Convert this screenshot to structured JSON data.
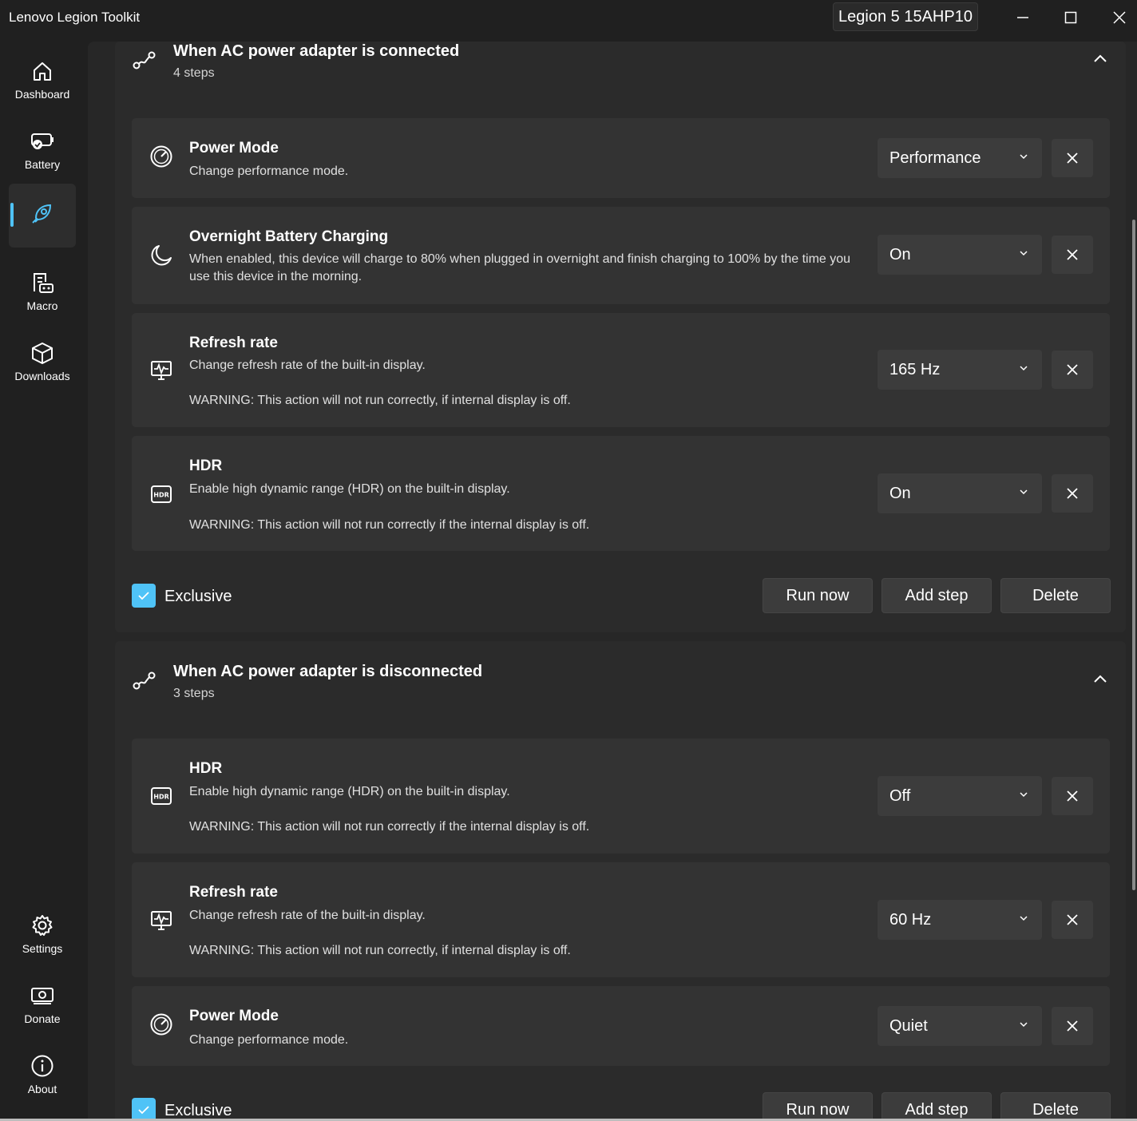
{
  "window": {
    "app_title": "Lenovo Legion Toolkit",
    "device": "Legion 5 15AHP10",
    "controls": [
      "minimize-icon",
      "maximize-icon",
      "close-icon"
    ]
  },
  "sidebar": {
    "items": [
      {
        "label": "Dashboard",
        "icon": "home-icon"
      },
      {
        "label": "Battery",
        "icon": "battery-icon"
      },
      {
        "label": "",
        "icon": "automation-icon",
        "active": true
      },
      {
        "label": "Macro",
        "icon": "macro-icon"
      },
      {
        "label": "Downloads",
        "icon": "box-icon"
      },
      {
        "label": "Settings",
        "icon": "gear-icon"
      },
      {
        "label": "Donate",
        "icon": "money-icon"
      },
      {
        "label": "About",
        "icon": "info-icon"
      }
    ]
  },
  "colors": {
    "accent": "#4fc3f7",
    "background": "#202020",
    "card": "#2b2b2b",
    "step": "#333333",
    "control": "#3c3c3c"
  },
  "pipelines": [
    {
      "title": "When AC power adapter is connected",
      "subtitle": "4 steps",
      "steps": [
        {
          "title": "Power Mode",
          "desc": "Change performance mode.",
          "value": "Performance",
          "icon": "speedometer-icon"
        },
        {
          "title": "Overnight Battery Charging",
          "desc": "When enabled, this device will charge to 80% when plugged in overnight and finish charging to 100% by the time you use this device in the morning.",
          "value": "On",
          "icon": "moon-icon"
        },
        {
          "title": "Refresh rate",
          "desc": "Change refresh rate of the built-in display.",
          "warn": "WARNING: This action will not run correctly, if internal display is off.",
          "value": "165 Hz",
          "icon": "monitor-pulse-icon"
        },
        {
          "title": "HDR",
          "desc": "Enable high dynamic range (HDR) on the built-in display.",
          "warn": "WARNING: This action will not run correctly if the internal display is off.",
          "value": "On",
          "icon": "hdr-icon"
        }
      ],
      "exclusive_label": "Exclusive",
      "exclusive": true,
      "buttons": {
        "run": "Run now",
        "add": "Add step",
        "delete": "Delete"
      }
    },
    {
      "title": "When AC power adapter is disconnected",
      "subtitle": "3 steps",
      "steps": [
        {
          "title": "HDR",
          "desc": "Enable high dynamic range (HDR) on the built-in display.",
          "warn": "WARNING: This action will not run correctly if the internal display is off.",
          "value": "Off",
          "icon": "hdr-icon"
        },
        {
          "title": "Refresh rate",
          "desc": "Change refresh rate of the built-in display.",
          "warn": "WARNING: This action will not run correctly, if internal display is off.",
          "value": "60 Hz",
          "icon": "monitor-pulse-icon"
        },
        {
          "title": "Power Mode",
          "desc": "Change performance mode.",
          "value": "Quiet",
          "icon": "speedometer-icon"
        }
      ],
      "exclusive_label": "Exclusive",
      "exclusive": true,
      "buttons": {
        "run": "Run now",
        "add": "Add step",
        "delete": "Delete"
      }
    }
  ]
}
